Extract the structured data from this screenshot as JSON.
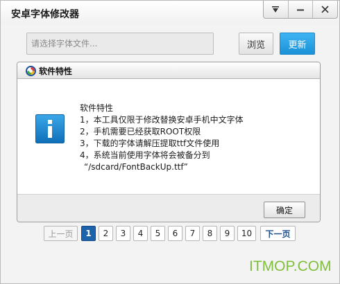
{
  "window": {
    "title": "安卓字体修改器",
    "controls": {
      "menu_icon": "dropdown-triangle",
      "minimize_icon": "minus",
      "close_icon": "x"
    }
  },
  "toolbar": {
    "file_placeholder": "请选择字体文件...",
    "browse_label": "浏览",
    "update_label": "更新"
  },
  "panel": {
    "title": "软件特性",
    "icon": "info-icon",
    "lines": [
      "软件特性",
      "1，本工具仅限于修改替换安卓手机中文字体",
      "2，手机需要已经获取ROOT权限",
      "3，下载的字体请解压提取ttf文件使用",
      "4，系统当前使用字体将会被备分到",
      "“/sdcard/FontBackUp.ttf”"
    ],
    "ok_label": "确定"
  },
  "pagination": {
    "prev_label": "上一页",
    "next_label": "下一页",
    "pages": [
      "1",
      "2",
      "3",
      "4",
      "5",
      "6",
      "7",
      "8",
      "9",
      "10"
    ],
    "current": "1"
  },
  "watermark": "ITMOP.COM",
  "colors": {
    "accent": "#1b92d7",
    "active_page": "#1d63ac",
    "watermark": "#7fbf3a"
  }
}
